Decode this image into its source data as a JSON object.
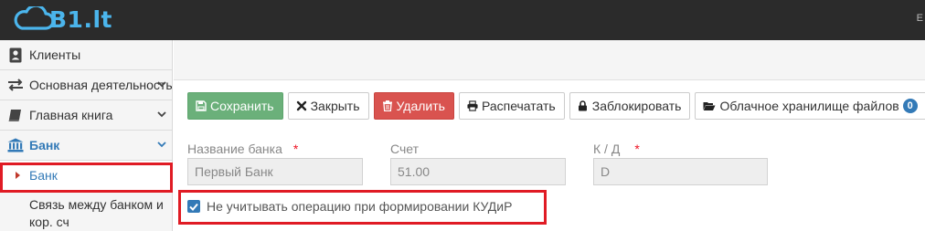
{
  "app": {
    "logo_text": "B1.lt",
    "top_right_glyph": "E"
  },
  "sidebar": {
    "items": [
      {
        "label": "Клиенты",
        "icon": "address-book-icon"
      },
      {
        "label": "Основная деятельность",
        "icon": "exchange-arrows-icon"
      },
      {
        "label": "Главная книга",
        "icon": "book-icon"
      },
      {
        "label": "Банк",
        "icon": "bank-icon"
      }
    ],
    "sub_active": "Банк",
    "sub_next": "Связь между банком и кор. сч"
  },
  "toolbar": {
    "save_label": "Сохранить",
    "close_label": "Закрыть",
    "delete_label": "Удалить",
    "print_label": "Распечатать",
    "lock_label": "Заблокировать",
    "cloud_label": "Облачное хранилище файлов",
    "cloud_count": "0"
  },
  "form": {
    "bank_name_label": "Название банка",
    "bank_name_value": "Первый Банк",
    "account_label": "Счет",
    "account_value": "51.00",
    "kd_label": "К / Д",
    "kd_value": "D",
    "required_mark": "*",
    "checkbox_label": "Не учитывать операцию при формировании КУДиР",
    "checkbox_checked": true
  },
  "colors": {
    "topbar": "#2b2b2b",
    "brand": "#4bb5ec",
    "save": "#6bb07a",
    "delete": "#d9534f",
    "highlight": "#e01b24",
    "link": "#337ab7"
  }
}
